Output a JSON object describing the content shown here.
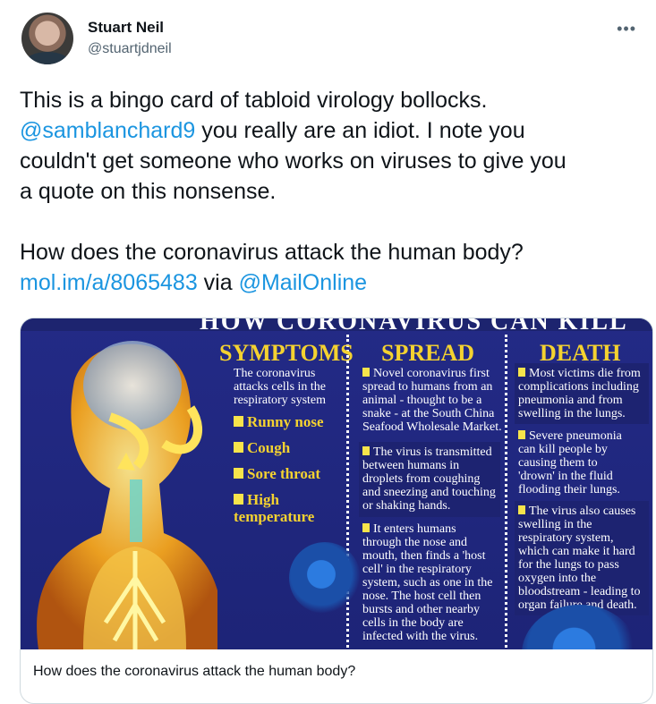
{
  "author": {
    "name": "Stuart Neil",
    "handle": "@stuartjdneil"
  },
  "menu_icon": "more-dots-icon",
  "tweet": {
    "line1": "This is a bingo card of tabloid virology bollocks.",
    "mention": "@samblanchard9",
    "line2_rest": " you really are an idiot. I note you",
    "line3": "couldn't get someone who works on viruses to give you",
    "line4": "a quote on this nonsense.",
    "line5": "How does the coronavirus attack the human body?",
    "url": "mol.im/a/8065483",
    "via": " via ",
    "via_handle": "@MailOnline"
  },
  "card": {
    "caption": "How does the coronavirus attack the human body?",
    "image": {
      "headline": "HOW CORONAVIRUS CAN KILL",
      "symptoms": {
        "title": "SYMPTOMS",
        "intro": [
          "The coronavirus",
          "attacks cells in the",
          "respiratory system"
        ],
        "items": [
          "Runny nose",
          "Cough",
          "Sore throat",
          "High",
          "temperature"
        ]
      },
      "spread": {
        "title": "SPREAD",
        "p1": [
          "Novel coronavirus first",
          "spread to humans from an",
          "animal - thought to be a",
          "snake - at the South China",
          "Seafood Wholesale Market."
        ],
        "p2": [
          "The virus is transmitted",
          "between humans in",
          "droplets from coughing",
          "and sneezing and  touching",
          "or shaking hands."
        ],
        "p3": [
          "It enters humans",
          "through the nose and",
          "mouth, then finds a 'host",
          "cell' in the respiratory",
          "system, such as one in the",
          "nose. The host cell then",
          "bursts and other nearby",
          "cells in the body are",
          "infected with the virus."
        ]
      },
      "death": {
        "title": "DEATH",
        "p1": [
          "Most victims die from",
          "complications including",
          "pneumonia and from",
          "swelling in the lungs."
        ],
        "p2": [
          "Severe pneumonia",
          "can kill people by",
          "causing them to",
          "'drown' in the fluid",
          "flooding their lungs."
        ],
        "p3": [
          "The virus also causes",
          "swelling in the",
          "respiratory system,",
          "which can make it hard",
          "for the lungs to pass",
          "oxygen into the",
          "bloodstream - leading to",
          "organ failure and death."
        ]
      }
    }
  },
  "colors": {
    "link": "#1b95e0",
    "infographic_bg": "#232a86",
    "infographic_title": "#f4d230"
  }
}
